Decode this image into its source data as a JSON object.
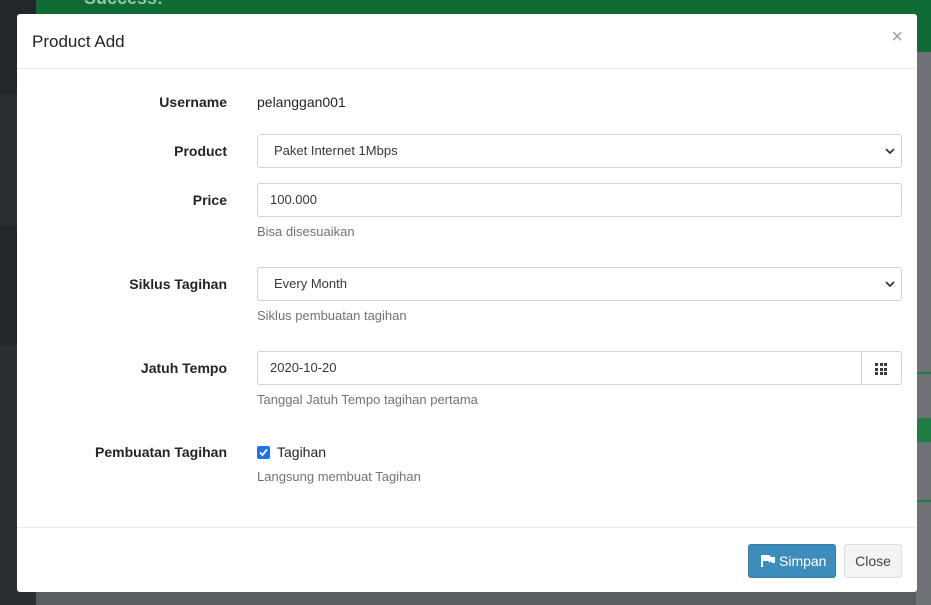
{
  "background": {
    "alert_text": "Success!"
  },
  "modal": {
    "title": "Product Add",
    "close_glyph": "×"
  },
  "form": {
    "username": {
      "label": "Username",
      "value": "pelanggan001"
    },
    "product": {
      "label": "Product",
      "selected": "Paket Internet 1Mbps"
    },
    "price": {
      "label": "Price",
      "value": "100.000",
      "help": "Bisa disesuaikan"
    },
    "billing_cycle": {
      "label": "Siklus Tagihan",
      "selected": "Every Month",
      "help": "Siklus pembuatan tagihan"
    },
    "due_date": {
      "label": "Jatuh Tempo",
      "value": "2020-10-20",
      "help": "Tanggal Jatuh Tempo tagihan pertama",
      "icon": "calendar-grid-icon"
    },
    "invoice_creation": {
      "label": "Pembuatan Tagihan",
      "checkbox_label": "Tagihan",
      "checked": true,
      "help": "Langsung membuat Tagihan"
    }
  },
  "footer": {
    "save_label": "Simpan",
    "save_icon": "save-arrow-icon",
    "close_label": "Close"
  },
  "colors": {
    "primary": "#3c8dbc",
    "success_bg": "#0f6b34",
    "checkbox": "#1a73e8"
  }
}
